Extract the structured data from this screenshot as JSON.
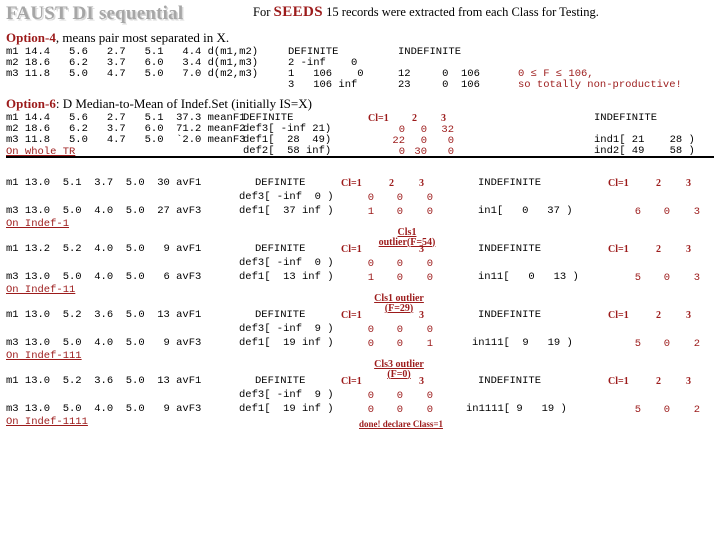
{
  "title": "FAUST DI sequential",
  "header_note": {
    "prefix": "For ",
    "emphasis": "SEEDS",
    "suffix": " 15 records were extracted from each Class for Testing."
  },
  "option4": {
    "label": "Option-4",
    "text": ", means pair most separated in X."
  },
  "option6": {
    "label": "Option-6",
    "text": ": D Median-to-Mean of Indef.Set (initially IS=X)"
  },
  "option4_block": {
    "left_rows": [
      "m1 14.4   5.6   2.7   5.1   4.4 d(m1,m2)",
      "m2 18.6   6.2   3.7   6.0   3.4 d(m1,m3)",
      "m3 11.8   5.0   4.7   5.0   7.0 d(m2,m3)"
    ],
    "definite_header": "DEFINITE",
    "indefinite_header": "INDEFINITE",
    "definite_rows": [
      "2 -inf    0",
      "1   106    0",
      "3   106 inf"
    ],
    "indefinite_rows": [
      "",
      "12     0  106",
      "23     0  106"
    ],
    "note_line1": "0 ≤ F ≤ 106,",
    "note_line2": "so totally non-productive!"
  },
  "option6_block": {
    "left_rows": [
      "m1 14.4   5.6   2.7   5.1  37.3 meanF1",
      "m2 18.6   6.2   3.7   6.0  71.2 meanF2",
      "m3 11.8   5.0   4.7   5.0  `2.0 meanF3"
    ],
    "footer_label": "On whole TR",
    "definite_header": "DEFINITE",
    "indefinite_header": "INDEFINITE",
    "class_cols": [
      "Cl=1",
      "2",
      "3"
    ],
    "definite_rows": [
      {
        "interval": "def3[ -inf 21)",
        "counts": [
          "0",
          "0",
          "32"
        ]
      },
      {
        "interval": "def1[  28  49)",
        "counts": [
          "22",
          "0",
          "0"
        ]
      },
      {
        "interval": "def2[  58 inf)",
        "counts": [
          "0",
          "30",
          "0"
        ]
      }
    ],
    "indefinite_rows": [
      "ind1[ 21    28 )",
      "ind2[ 49    58 )"
    ]
  },
  "blocks": [
    {
      "left_rows": [
        "m1 13.0  5.1  3.7  5.0  30 avF1",
        "m3 13.0  5.0  4.0  5.0  27 avF3"
      ],
      "footer_label": "On Indef-1",
      "definite_header": "DEFINITE",
      "indefinite_header": "INDEFINITE",
      "class_cols": [
        "Cl=1",
        "2",
        "3"
      ],
      "definite_rows": [
        {
          "interval": "def3[ -inf  0 )",
          "counts": [
            "0",
            "0",
            "0"
          ]
        },
        {
          "interval": "def1[  37 inf )",
          "counts": [
            "1",
            "0",
            "0"
          ]
        }
      ],
      "indefinite_row": {
        "interval": "in1[   0   37 )",
        "counts": [
          "6",
          "0",
          "3"
        ]
      },
      "annotation": null
    },
    {
      "left_rows": [
        "m1 13.2  5.2  4.0  5.0   9 avF1",
        "m3 13.0  5.0  4.0  5.0   6 avF3"
      ],
      "footer_label": "On Indef-11",
      "definite_header": "DEFINITE",
      "indefinite_header": "INDEFINITE",
      "class_cols": [
        "Cl=1",
        "2",
        "3"
      ],
      "definite_rows": [
        {
          "interval": "def3[ -inf  0 )",
          "counts": [
            "0",
            "0",
            "0"
          ]
        },
        {
          "interval": "def1[  13 inf )",
          "counts": [
            "1",
            "0",
            "0"
          ]
        }
      ],
      "indefinite_row": {
        "interval": "in11[   0   13 )",
        "counts": [
          "5",
          "0",
          "3"
        ]
      },
      "annotation": "Cls1 outlier(F=54)"
    },
    {
      "left_rows": [
        "m1 13.0  5.2  3.6  5.0  13 avF1",
        "m3 13.0  5.0  4.0  5.0   9 avF3"
      ],
      "footer_label": "On Indef-111",
      "definite_header": "DEFINITE",
      "indefinite_header": "INDEFINITE",
      "class_cols": [
        "Cl=1",
        "2",
        "3"
      ],
      "definite_rows": [
        {
          "interval": "def3[ -inf  9 )",
          "counts": [
            "0",
            "0",
            "0"
          ]
        },
        {
          "interval": "def1[  19 inf )",
          "counts": [
            "0",
            "0",
            "1"
          ]
        }
      ],
      "indefinite_row": {
        "interval": "in111[  9   19 )",
        "counts": [
          "5",
          "0",
          "2"
        ]
      },
      "annotation": "Cls1 outlier (F=29)"
    },
    {
      "left_rows": [
        "m1 13.0  5.2  3.6  5.0  13 avF1",
        "m3 13.0  5.0  4.0  5.0   9 avF3"
      ],
      "footer_label": "On Indef-1111",
      "definite_header": "DEFINITE",
      "indefinite_header": "INDEFINITE",
      "class_cols": [
        "Cl=1",
        "2",
        "3"
      ],
      "definite_rows": [
        {
          "interval": "def3[ -inf  9 )",
          "counts": [
            "0",
            "0",
            "0"
          ]
        },
        {
          "interval": "def1[  19 inf )",
          "counts": [
            "0",
            "0",
            "0"
          ]
        }
      ],
      "indefinite_row": {
        "interval": "in1111[ 9   19 )",
        "counts": [
          "5",
          "0",
          "2"
        ]
      },
      "annotation": "Cls3 outlier (F=0)",
      "conclusion": "done! declare Class=1"
    }
  ],
  "colors": {
    "accent_red": "#9c1b1b",
    "title_grey": "#a6a6a6",
    "title_shadow": "#d9d9d9",
    "text_black": "#000000"
  }
}
